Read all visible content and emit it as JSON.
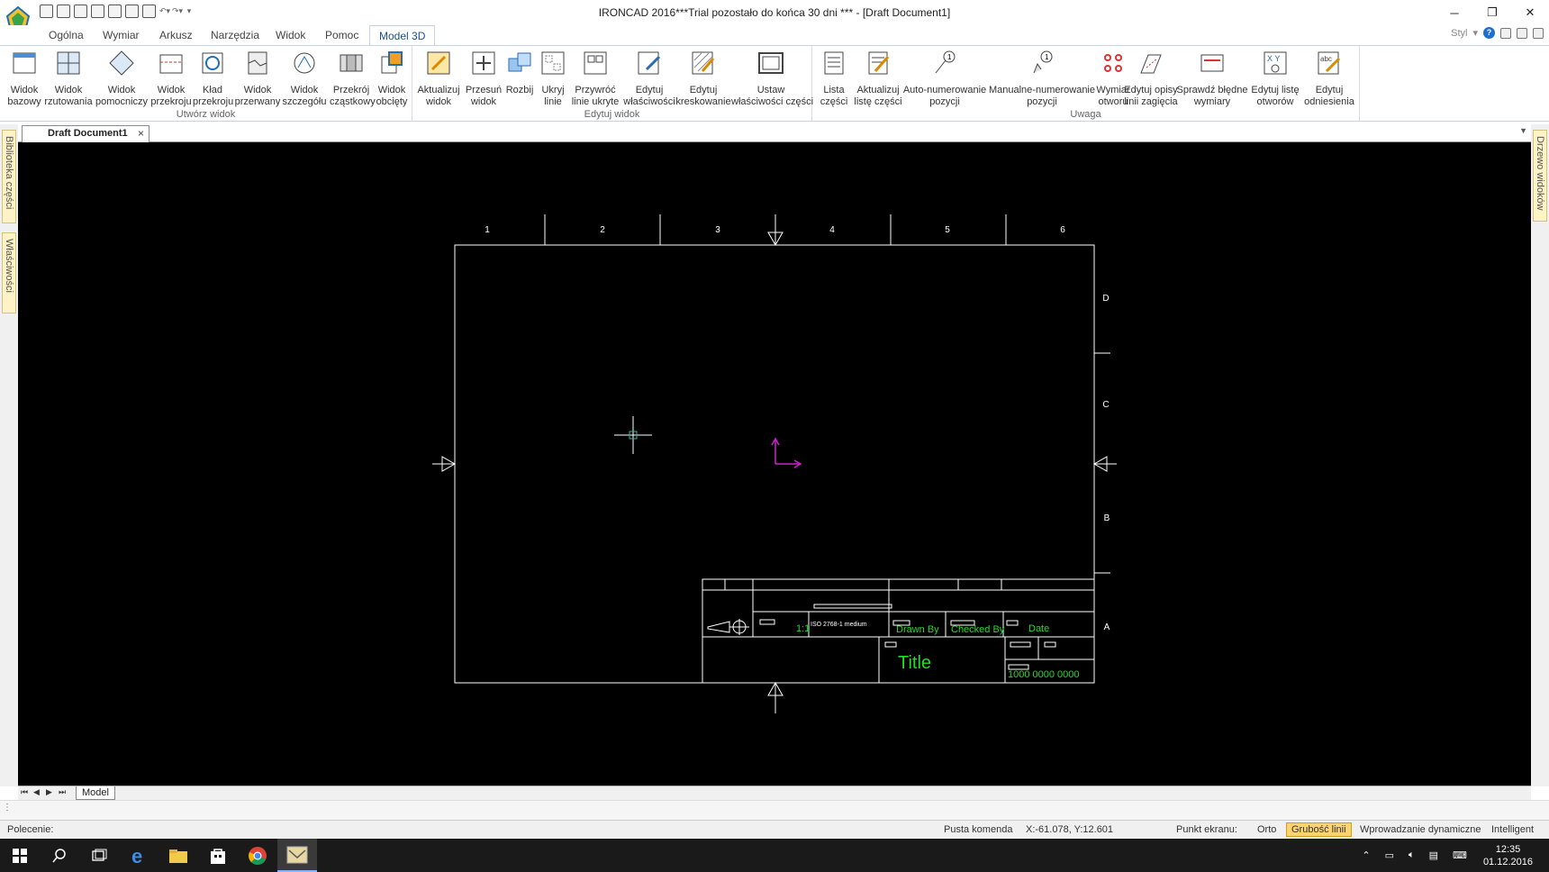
{
  "window": {
    "title": "IRONCAD 2016***Trial pozostało do końca 30 dni *** - [Draft Document1]",
    "minimize": "─",
    "restore": "❐",
    "close": "✕"
  },
  "ribbon_tabs": [
    "Ogólna",
    "Wymiar",
    "Arkusz",
    "Narzędzia",
    "Widok",
    "Pomoc",
    "Model 3D"
  ],
  "style_label": "Styl",
  "groups": {
    "create": {
      "label": "Utwórz widok",
      "buttons": [
        {
          "label": "Widok\nbazowy"
        },
        {
          "label": "Widok\nrzutowania"
        },
        {
          "label": "Widok\npomocniczy"
        },
        {
          "label": "Widok\nprzekroju"
        },
        {
          "label": "Kład\nprzekroju"
        },
        {
          "label": "Widok\nprzerwany"
        },
        {
          "label": "Widok\nszczegółu"
        },
        {
          "label": "Przekrój\ncząstkowy"
        },
        {
          "label": "Widok\nobcięty"
        }
      ]
    },
    "edit": {
      "label": "Edytuj widok",
      "buttons": [
        {
          "label": "Aktualizuj\nwidok"
        },
        {
          "label": "Przesuń\nwidok"
        },
        {
          "label": "Rozbij"
        },
        {
          "label": "Ukryj\nlinie"
        },
        {
          "label": "Przywróć\nlinie ukryte"
        },
        {
          "label": "Edytuj\nwłaściwości"
        },
        {
          "label": "Edytuj\nkreskowanie"
        },
        {
          "label": "Ustaw\nwłaściwości części"
        }
      ]
    },
    "note": {
      "label": "Uwaga",
      "buttons": [
        {
          "label": "Lista\nczęści"
        },
        {
          "label": "Aktualizuj\nlistę części"
        },
        {
          "label": "Auto-numerowanie\npozycji"
        },
        {
          "label": "Manualne-numerowanie\npozycji"
        },
        {
          "label": "Wymiar\notworu"
        },
        {
          "label": "Edytuj opisy\nlinii zagięcia"
        },
        {
          "label": "Sprawdź błędne\nwymiary"
        },
        {
          "label": "Edytuj listę\notworów"
        },
        {
          "label": "Edytuj\nodniesienia"
        }
      ]
    }
  },
  "document": {
    "tab_title": "Draft Document1",
    "close": "×"
  },
  "side_panels": {
    "left_top": "Biblioteka części",
    "left_bottom": "Właściwości",
    "right_top": "Drzewo widoków"
  },
  "drawing": {
    "zone_cols": [
      "1",
      "2",
      "3",
      "4",
      "5",
      "6"
    ],
    "zone_rows": [
      "D",
      "C",
      "B",
      "A"
    ],
    "title_block": {
      "scale": "1:1",
      "tolerance": "ISO 2768-1 medium",
      "drawn_by": "Drawn By",
      "checked_by": "Checked By",
      "date": "Date",
      "title": "Title",
      "number": "1000 0000 0000"
    }
  },
  "sheet_tabs": {
    "nav": [
      "⏮",
      "◀",
      "▶",
      "⏭"
    ],
    "active": "Model"
  },
  "status": {
    "command_label": "Polecenie:",
    "empty_command": "Pusta komenda",
    "coords": "X:-61.078, Y:12.601",
    "screen_point": "Punkt ekranu:",
    "ortho": "Orto",
    "line_weight": "Grubość linii",
    "dynamic_input": "Wprowadzanie dynamiczne",
    "intelligent": "Intelligent"
  },
  "taskbar": {
    "time": "12:35",
    "date": "01.12.2016"
  },
  "colors": {
    "canvas": "#000000",
    "drawing_line": "#ffffff",
    "title_text": "#22dd22",
    "cursor": "#ffffff",
    "axis": "#cc22cc",
    "accent_tab": "#1a4f8f"
  }
}
